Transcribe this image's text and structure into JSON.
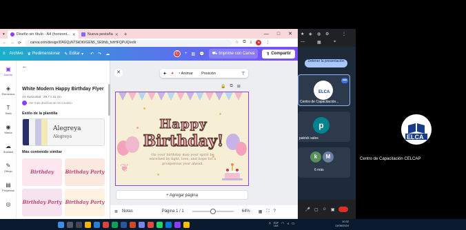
{
  "browser": {
    "tabs": [
      {
        "label": "Diseño sin título - A4 (horizont...",
        "active": true
      },
      {
        "label": "Nueva pestaña",
        "active": false
      }
    ],
    "url": "canva.com/design/DAGQyN7SkDt0/GEN5_SE9fsb_fvhHFQPUQ/edit"
  },
  "canva_header": {
    "archivo": "Archivo",
    "redimensionar": "Redimensionar",
    "editar": "Editar",
    "avatar_letter": "C",
    "print": "Imprime con Canva",
    "share": "Compartir"
  },
  "rail": [
    {
      "label": "Diseño",
      "active": true
    },
    {
      "label": "Elementos",
      "active": false
    },
    {
      "label": "Texto",
      "active": false
    },
    {
      "label": "Marca",
      "active": false
    },
    {
      "label": "Subidos",
      "active": false
    },
    {
      "label": "Dibujo",
      "active": false
    },
    {
      "label": "Proyectos",
      "active": false
    },
    {
      "label": "Apps",
      "active": false
    }
  ],
  "panel": {
    "title": "White Modern Happy Birthday Flyer",
    "size": "A4 Horizontal · 29.7 x 21 cm",
    "author": "Ver más diseños de Alt creativo",
    "style_heading": "Estilo de la plantilla",
    "font_big": "Alegreya",
    "font_small": "Alegreya",
    "similar_heading": "Más contenido similar",
    "swatch_colors": [
      "#2a2f6b",
      "#f3f3f3",
      "#c9c7e8",
      "#f4e9b7"
    ],
    "thumbs": [
      "Birthday",
      "Birthday Party",
      "Birthday Party",
      "Birthday Party"
    ]
  },
  "toolbar": {
    "animate": "Animar",
    "position": "Posición"
  },
  "flyer": {
    "happy": "Happy",
    "birthday": "Birthday!",
    "message": "On your birthday may your spirit be enriched by light, love, and hope for a prosperous year ahead."
  },
  "canvas": {
    "add_page": "+ Agregar página",
    "notes": "Notas",
    "page": "Página 1 / 1",
    "zoom": "64%"
  },
  "meet": {
    "stop_presenting": "Detener la presentación",
    "tile1_name": "Centro de Capacitación...",
    "tile2_letter": "p",
    "tile2_name": "patrick sales",
    "tile3_letters": [
      "k",
      "M"
    ],
    "tile3_more": "6 más",
    "self_name": "Centro de Capacitación CELCAP",
    "logo_text": "ELCA"
  },
  "taskbar": {
    "lang": "ESP\nLAA",
    "time": "10:32\n11/06/2024"
  }
}
